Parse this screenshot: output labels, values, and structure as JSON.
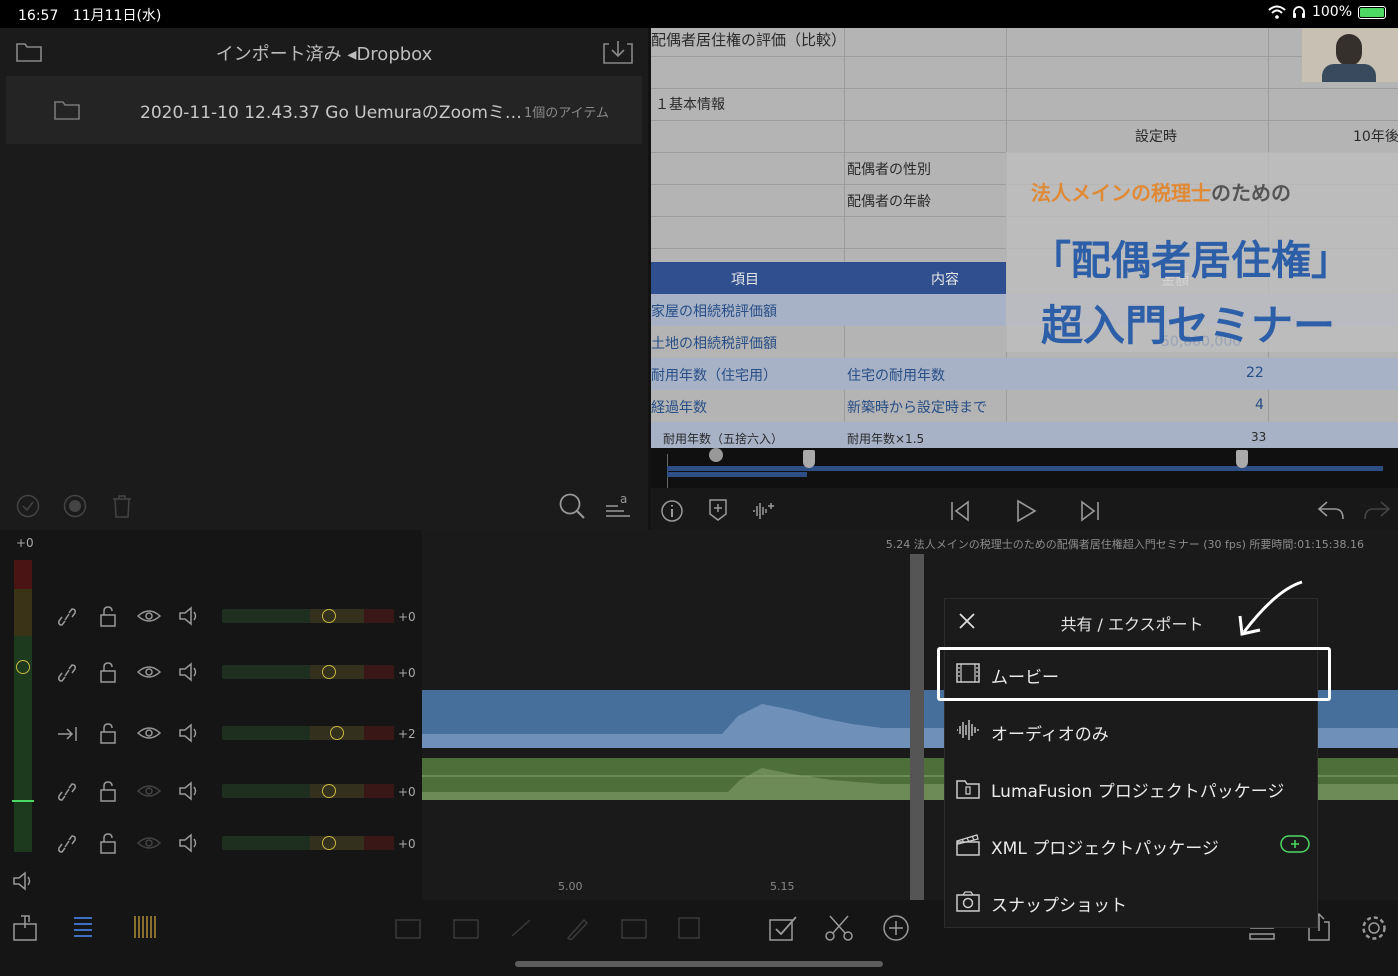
{
  "status_bar": {
    "time": "16:57",
    "date": "11月11日(水)",
    "battery": "100%"
  },
  "library": {
    "title": "インポート済み ◂Dropbox",
    "folder": {
      "name": "2020-11-10 12.43.37 Go UemuraのZoomミ…",
      "count": "1個のアイテム"
    }
  },
  "preview": {
    "sheet_title": "配偶者居住権の評価（比較）",
    "section": "１基本情報",
    "col_setting": "設定時",
    "col_10y": "10年後",
    "spouse_gender": "配偶者の性別",
    "spouse_age": "配偶者の年齢",
    "hdr_item": "項目",
    "hdr_content": "内容",
    "hdr_amount": "金額",
    "row_house": "家屋の相続税評価額",
    "row_land": "土地の相続税評価額",
    "row_land_value": "50,000,000",
    "row_life": "耐用年数（住宅用）",
    "row_life_desc": "住宅の耐用年数",
    "row_life_val": "22",
    "row_elapsed": "経過年数",
    "row_elapsed_desc": "新築時から設定時まで",
    "row_elapsed_val": "4",
    "row_round": "耐用年数（五捨六入）",
    "row_round_desc": "耐用年数×1.5",
    "row_round_val": "33",
    "overlay_sub_a": "法人メインの税理士",
    "overlay_sub_b": "のための",
    "overlay_main": "「配偶者居住権」",
    "overlay_main2": "超入門セミナー"
  },
  "timeline": {
    "project_title": "5.24 法人メインの税理士のための配偶者居住権超入門セミナー (30 fps) 所要時間:01:15:38.16",
    "master_gain": "+0",
    "tracks": [
      {
        "gain": "+0",
        "knob": 0.62
      },
      {
        "gain": "+0",
        "knob": 0.62
      },
      {
        "gain": "+2",
        "knob": 0.67
      },
      {
        "gain": "+0",
        "knob": 0.62
      },
      {
        "gain": "+0",
        "knob": 0.62
      }
    ],
    "ruler_marks": [
      "5.00",
      "5.15"
    ]
  },
  "share_dialog": {
    "title": "共有 / エクスポート",
    "items": [
      {
        "label": "ムービー",
        "icon": "film-icon"
      },
      {
        "label": "オーディオのみ",
        "icon": "waveform-icon"
      },
      {
        "label": "LumaFusion プロジェクトパッケージ",
        "icon": "package-icon"
      },
      {
        "label": "XML プロジェクトパッケージ",
        "icon": "clapper-icon"
      },
      {
        "label": "スナップショット",
        "icon": "camera-icon"
      }
    ]
  },
  "colors": {
    "accent_green": "#4cd964",
    "video_track": "#476f9c",
    "audio_track": "#4e6e3a"
  }
}
